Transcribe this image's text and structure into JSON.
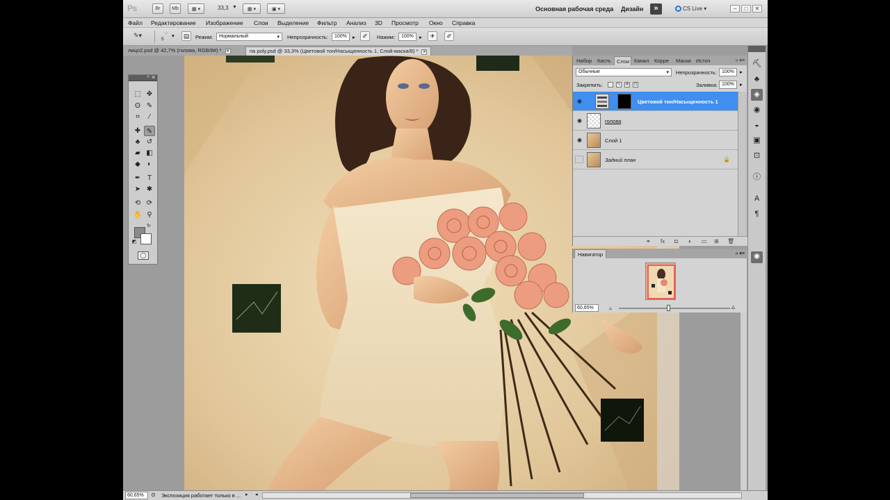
{
  "app": {
    "logo": "Ps",
    "zoom_value": "33,3",
    "workspace": "Основная рабочая среда",
    "design": "Дизайн",
    "design_more": "»",
    "cs_live": "CS Live",
    "bridge_label": "Br",
    "minibridge_label": "Mb"
  },
  "menu": [
    "Файл",
    "Редактирование",
    "Изображение",
    "Слои",
    "Выделение",
    "Фильтр",
    "Анализ",
    "3D",
    "Просмотр",
    "Окно",
    "Справка"
  ],
  "options": {
    "brush_size": "5",
    "mode_label": "Режим:",
    "mode_value": "Нормальный",
    "opacity_label": "Непрозрачность:",
    "opacity_value": "100%",
    "pressure_label": "Нажим:",
    "pressure_value": "100%"
  },
  "doc_tabs": [
    {
      "title": "лицо2.psd @ 42,7% (голова, RGB/8#) *",
      "active": false
    },
    {
      "title": "па poly.psd @ 33,3% (Цветовой тон/Насыщенность 1, Слой-маска/8) *",
      "active": true
    }
  ],
  "layers_panel": {
    "tabs": [
      "Набор",
      "Кисть",
      "Слои",
      "Канал",
      "Корре",
      "Маски",
      "Источ"
    ],
    "active_tab": "Слои",
    "blend_mode": "Обычные",
    "opacity_label": "Непрозрачность:",
    "opacity_value": "100%",
    "lock_label": "Закрепить:",
    "fill_label": "Заливка:",
    "fill_value": "100%",
    "layers": [
      {
        "name": "Цветовой тон/Насыщенность 1",
        "visible": true,
        "selected": true,
        "locked": false
      },
      {
        "name": "голова",
        "visible": true,
        "selected": false,
        "locked": false
      },
      {
        "name": "Слой 1",
        "visible": true,
        "selected": false,
        "locked": false
      },
      {
        "name": "Задний план",
        "visible": false,
        "selected": false,
        "locked": true
      }
    ],
    "footer_icons": [
      "link-icon",
      "fx-icon",
      "mask-icon",
      "adjustment-icon",
      "folder-icon",
      "new-layer-icon",
      "trash-icon"
    ]
  },
  "navigator": {
    "tab": "Навигатор",
    "zoom_value": "60,65%",
    "zoom_fraction": 0.45
  },
  "status": {
    "zoom": "60,65%",
    "message": "Экспозиция работает только в ..."
  },
  "colors": {
    "selection_blue": "#3f8ef0",
    "foreground": "#8a8a8a",
    "background": "#ffffff"
  }
}
